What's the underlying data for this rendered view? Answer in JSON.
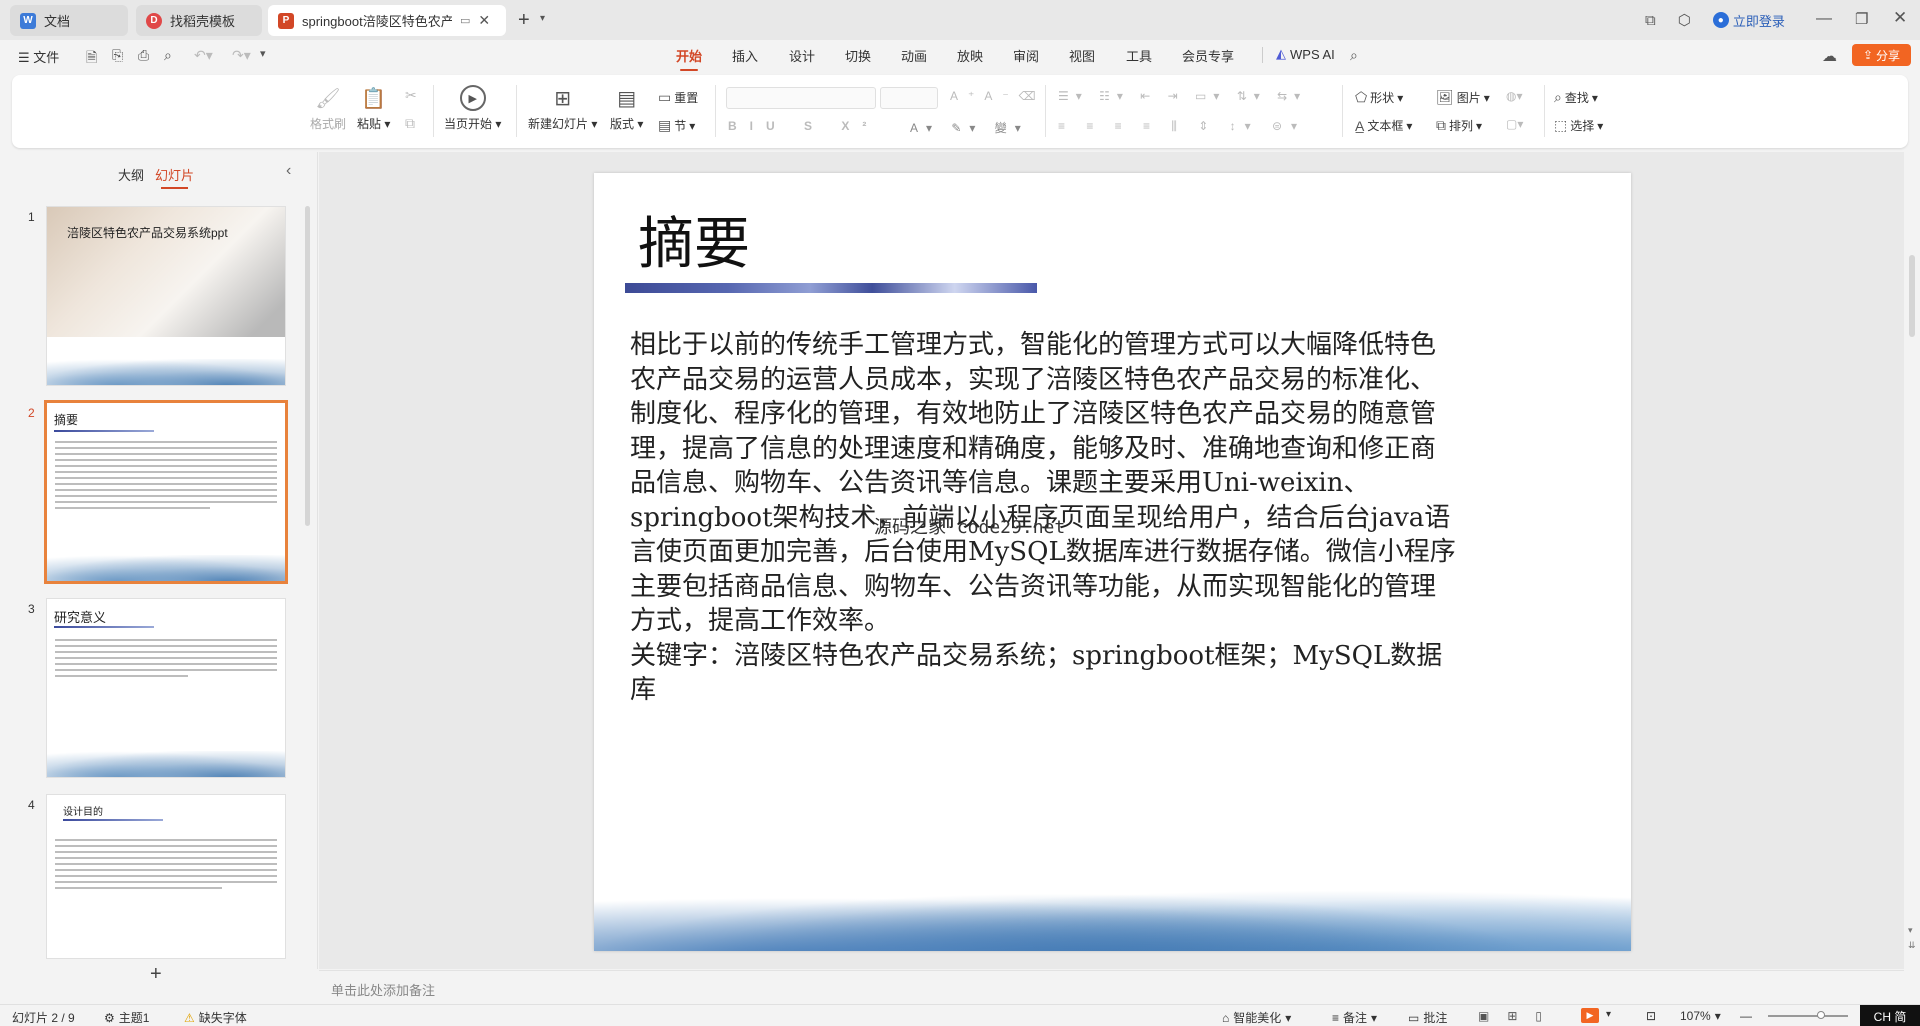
{
  "titlebar": {
    "tabs": [
      {
        "label": "文档",
        "icon": "wps-doc-icon"
      },
      {
        "label": "找稻壳模板",
        "icon": "docer-icon"
      },
      {
        "label": "springboot涪陵区特色农产品",
        "icon": "ppt-file-icon"
      }
    ],
    "login": "立即登录"
  },
  "menu": {
    "file": "文件",
    "tabs": [
      "开始",
      "插入",
      "设计",
      "切换",
      "动画",
      "放映",
      "审阅",
      "视图",
      "工具",
      "会员专享"
    ],
    "wps_ai": "WPS AI",
    "share": "分享"
  },
  "ribbon": {
    "format_painter": "格式刷",
    "paste": "粘贴",
    "play_from_current": "当页开始",
    "new_slide": "新建幻灯片",
    "layout": "版式",
    "reset": "重置",
    "section": "节",
    "shape": "形状",
    "picture": "图片",
    "textbox": "文本框",
    "arrange": "排列",
    "find": "查找",
    "select": "选择"
  },
  "sidepanel": {
    "tab_outline": "大纲",
    "tab_slides": "幻灯片",
    "add_label": "+",
    "slides": [
      {
        "num": "1",
        "title": "涪陵区特色农产品交易系统ppt"
      },
      {
        "num": "2",
        "title": "摘要"
      },
      {
        "num": "3",
        "title": "研究意义"
      },
      {
        "num": "4",
        "title": "设计目的"
      }
    ]
  },
  "slide": {
    "title": "摘要",
    "paragraphs": [
      "相比于以前的传统手工管理方式，智能化的管理方式可以大幅降低特色农产品交易的运营人员成本，实现了涪陵区特色农产品交易的标准化、制度化、程序化的管理，有效地防止了涪陵区特色农产品交易的随意管理，提高了信息的处理速度和精确度，能够及时、准确地查询和修正商品信息、购物车、公告资讯等信息。课题主要采用Uni-weixin、springboot架构技术，前端以小程序页面呈现给用户，结合后台java语言使页面更加完善，后台使用MySQL数据库进行数据存储。微信小程序主要包括商品信息、购物车、公告资讯等功能，从而实现智能化的管理方式，提高工作效率。",
      "关键字：涪陵区特色农产品交易系统；springboot框架；MySQL数据库"
    ],
    "watermark": "源码之家 code29.net"
  },
  "notes_placeholder": "单击此处添加备注",
  "statusbar": {
    "slide_counter": "幻灯片 2 / 9",
    "theme": "主题1",
    "missing_font": "缺失字体",
    "smart_beautify": "智能美化",
    "notes": "备注",
    "comments": "批注",
    "zoom": "107%",
    "ime": "CH 简"
  }
}
